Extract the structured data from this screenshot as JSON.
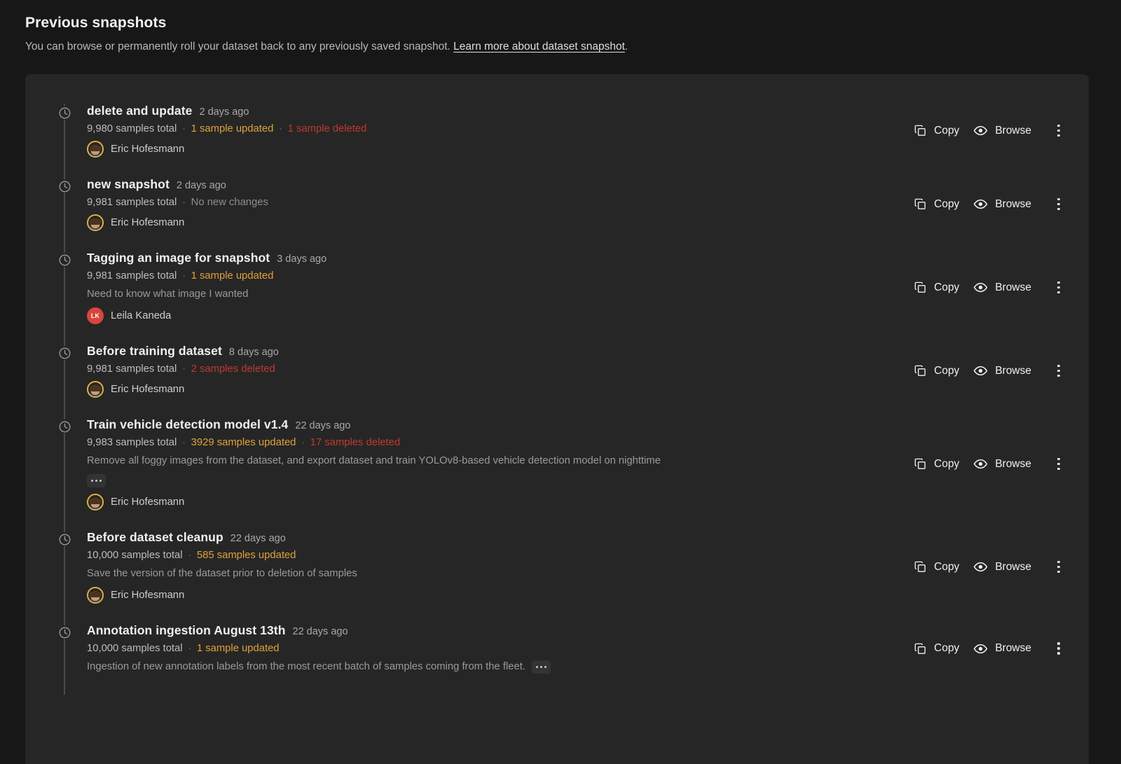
{
  "header": {
    "title": "Previous snapshots",
    "subtitle_before": "You can browse or permanently roll your dataset back to any previously saved snapshot. ",
    "link_label": "Learn more about dataset snapshot",
    "subtitle_after": "."
  },
  "actions": {
    "copy_label": "Copy",
    "browse_label": "Browse",
    "copy_icon": "copy-icon",
    "browse_icon": "eye-icon",
    "menu_icon": "kebab-menu-icon"
  },
  "colors": {
    "page_bg": "#171717",
    "panel_bg": "#262626",
    "updated": "#e0a13b",
    "deleted": "#c0392b",
    "neutral": "#8e8e8e",
    "avatar_initials_bg": "#d8453c"
  },
  "separator": "·",
  "snapshots": [
    {
      "name": "delete and update",
      "age": "2 days ago",
      "total": "9,980 samples total",
      "updated": "1 sample updated",
      "deleted": "1 sample deleted",
      "no_changes": "",
      "description": "",
      "truncated": false,
      "expand_label": "expand-description",
      "author": "Eric Hofesmann",
      "avatar_type": "photo",
      "avatar_initials": ""
    },
    {
      "name": "new snapshot",
      "age": "2 days ago",
      "total": "9,981 samples total",
      "updated": "",
      "deleted": "",
      "no_changes": "No new changes",
      "description": "",
      "truncated": false,
      "expand_label": "expand-description",
      "author": "Eric Hofesmann",
      "avatar_type": "photo",
      "avatar_initials": ""
    },
    {
      "name": "Tagging an image for snapshot",
      "age": "3 days ago",
      "total": "9,981 samples total",
      "updated": "1 sample updated",
      "deleted": "",
      "no_changes": "",
      "description": "Need to know what image I wanted",
      "truncated": false,
      "expand_label": "expand-description",
      "author": "Leila Kaneda",
      "avatar_type": "initials",
      "avatar_initials": "LK"
    },
    {
      "name": "Before training dataset",
      "age": "8 days ago",
      "total": "9,981 samples total",
      "updated": "",
      "deleted": "2 samples deleted",
      "no_changes": "",
      "description": "",
      "truncated": false,
      "expand_label": "expand-description",
      "author": "Eric Hofesmann",
      "avatar_type": "photo",
      "avatar_initials": ""
    },
    {
      "name": "Train vehicle detection model v1.4",
      "age": "22 days ago",
      "total": "9,983 samples total",
      "updated": "3929 samples updated",
      "deleted": "17 samples deleted",
      "no_changes": "",
      "description": "Remove all foggy images from the dataset, and export dataset and train YOLOv8-based vehicle detection model on nighttime",
      "truncated": true,
      "truncated_inline": false,
      "expand_label": "expand-description",
      "author": "Eric Hofesmann",
      "avatar_type": "photo",
      "avatar_initials": ""
    },
    {
      "name": "Before dataset cleanup",
      "age": "22 days ago",
      "total": "10,000 samples total",
      "updated": "585 samples updated",
      "deleted": "",
      "no_changes": "",
      "description": "Save the version of the dataset prior to deletion of samples",
      "truncated": false,
      "expand_label": "expand-description",
      "author": "Eric Hofesmann",
      "avatar_type": "photo",
      "avatar_initials": ""
    },
    {
      "name": "Annotation ingestion August 13th",
      "age": "22 days ago",
      "total": "10,000 samples total",
      "updated": "1 sample updated",
      "deleted": "",
      "no_changes": "",
      "description": "Ingestion of new annotation labels from the most recent batch of samples coming from the fleet.",
      "truncated": true,
      "truncated_inline": true,
      "expand_label": "expand-description",
      "author": "",
      "avatar_type": "none",
      "avatar_initials": ""
    }
  ]
}
